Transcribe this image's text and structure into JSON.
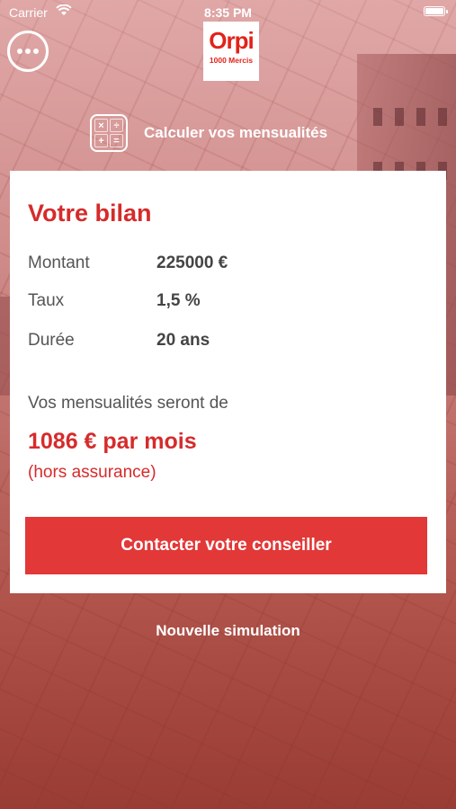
{
  "status_bar": {
    "carrier": "Carrier",
    "time": "8:35 PM"
  },
  "header": {
    "logo_brand": "Orpi",
    "logo_subtitle": "1000 Mercis",
    "menu_icon": "more-dots-icon"
  },
  "calculator": {
    "label": "Calculer vos mensualités",
    "icon": "calculator-icon"
  },
  "summary": {
    "title": "Votre bilan",
    "rows": [
      {
        "label": "Montant",
        "value": "225000 €"
      },
      {
        "label": "Taux",
        "value": "1,5 %"
      },
      {
        "label": "Durée",
        "value": "20 ans"
      }
    ],
    "intro": "Vos mensualités seront de",
    "monthly_amount": "1086 € par mois",
    "note": "(hors assurance)",
    "cta_label": "Contacter votre conseiller"
  },
  "footer": {
    "new_simulation_label": "Nouvelle simulation"
  },
  "colors": {
    "brand_red": "#e2231a",
    "accent_red": "#d62b2b",
    "button_red": "#e23838"
  }
}
